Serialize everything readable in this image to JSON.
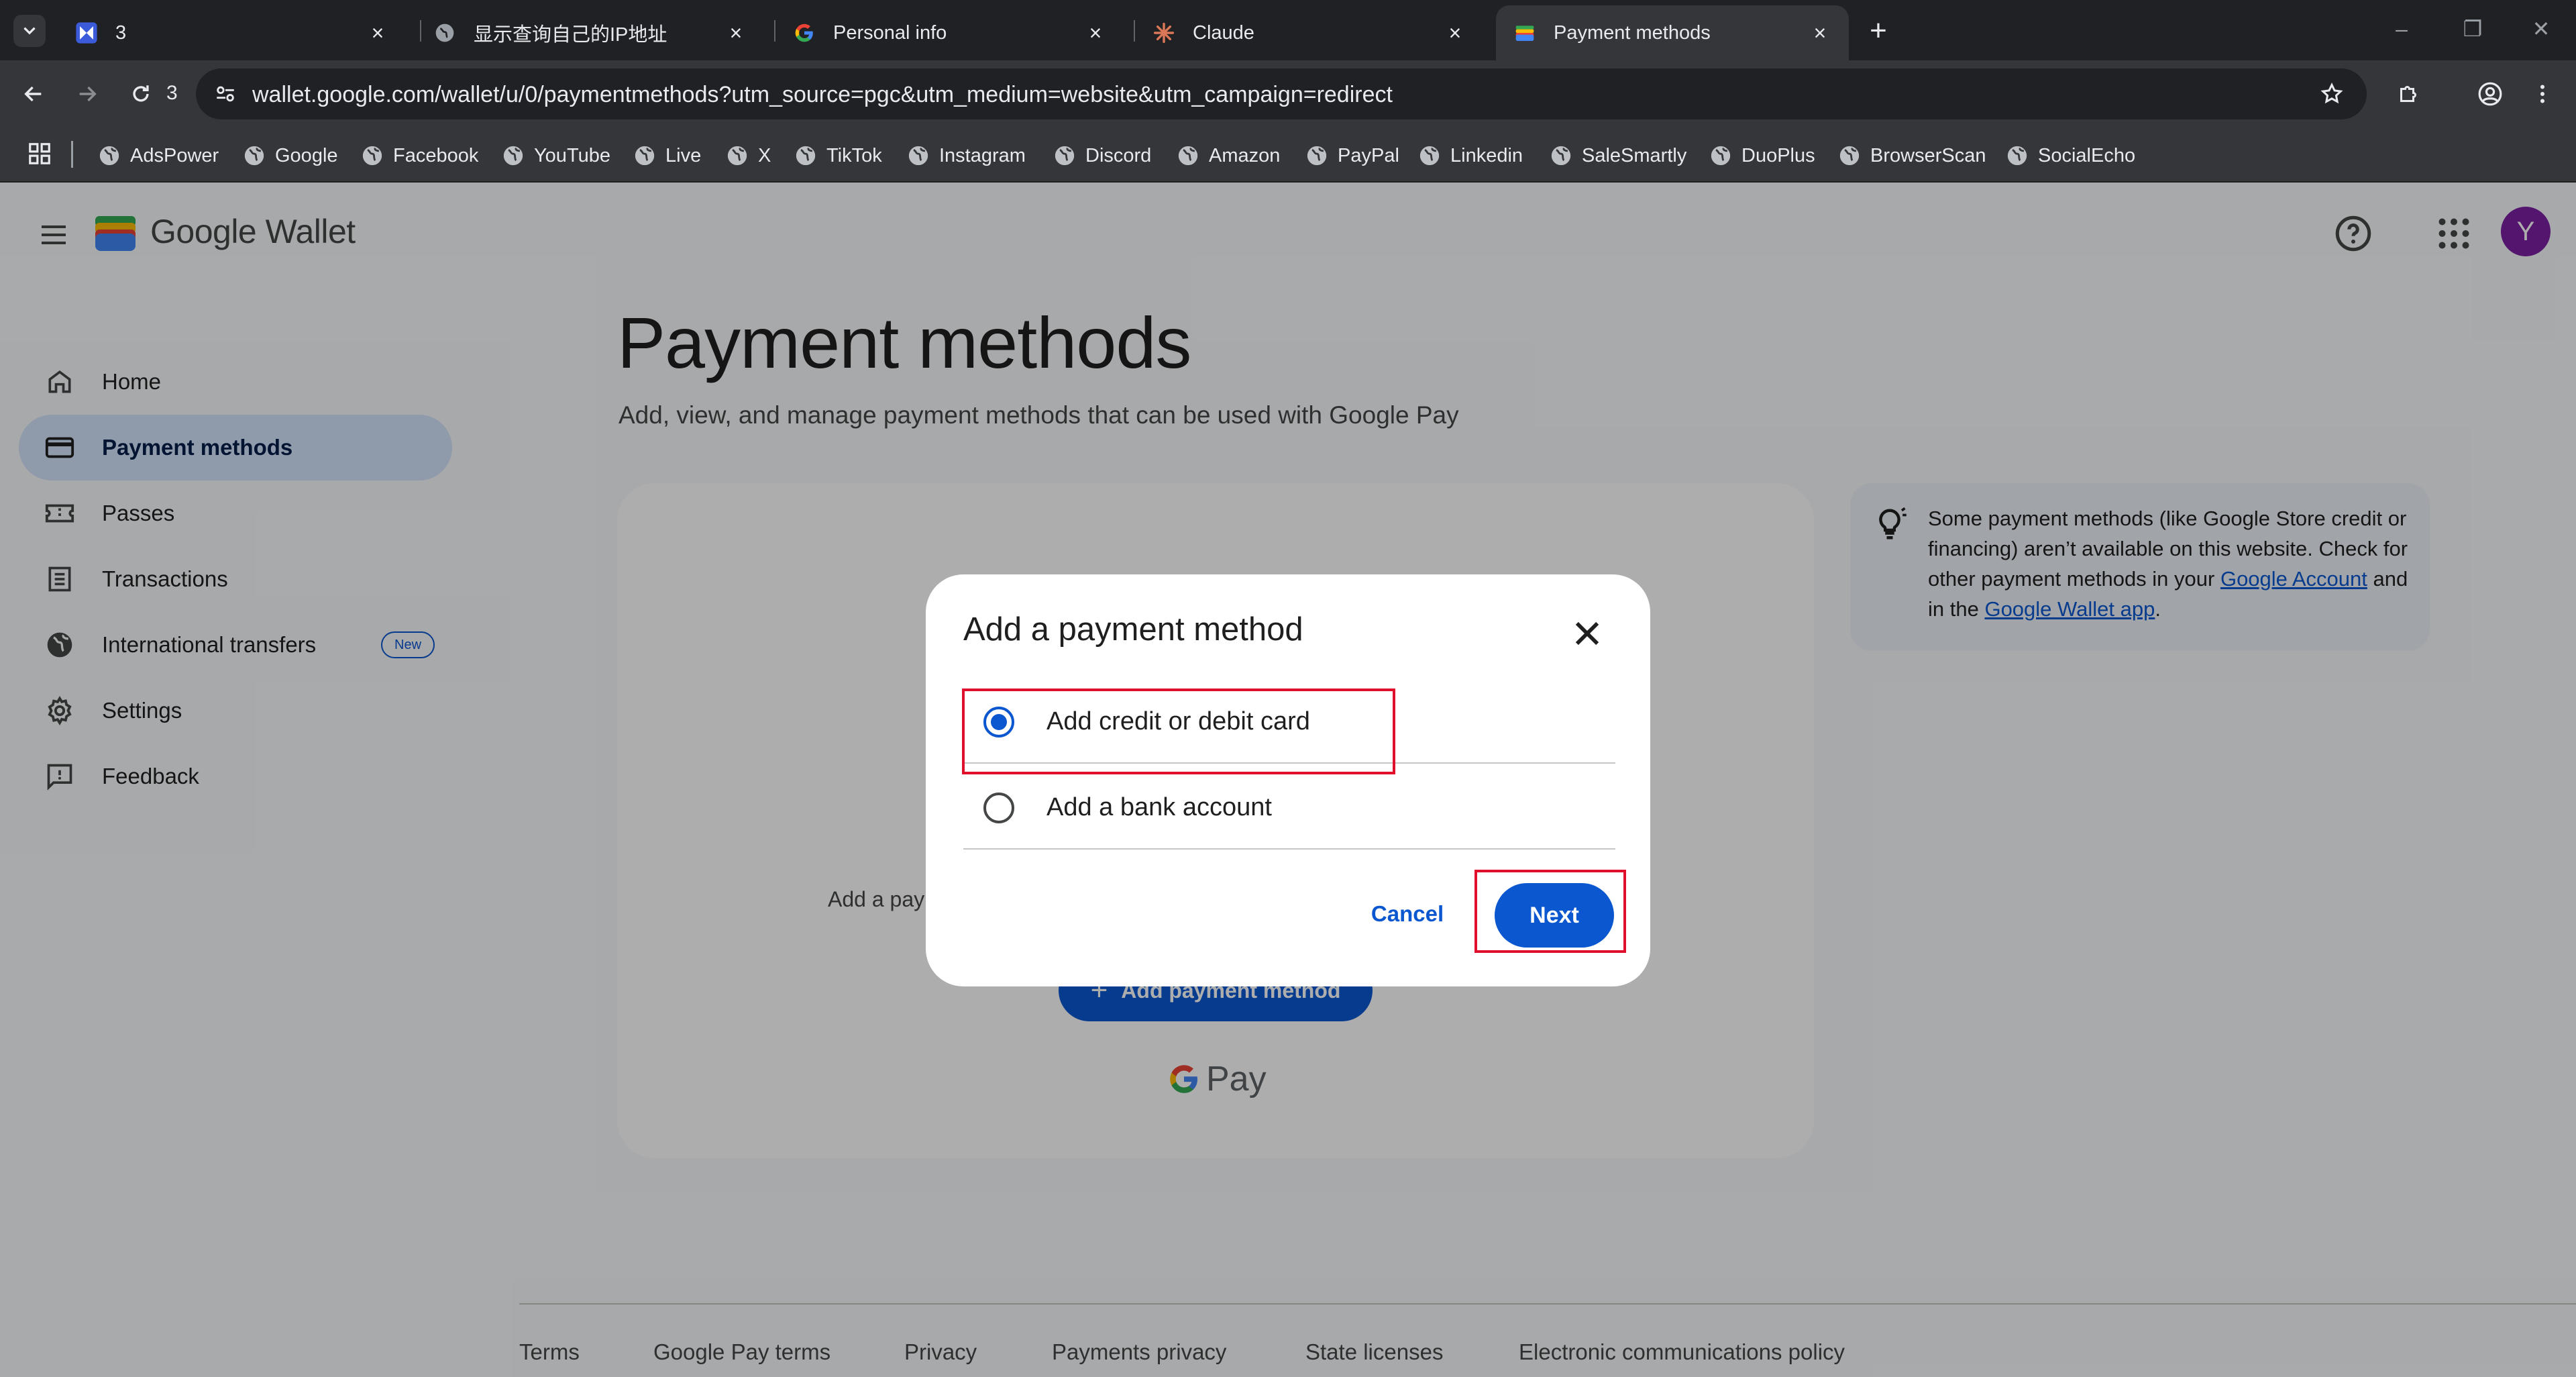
{
  "browser": {
    "tabs": [
      {
        "title": "3",
        "icon": "app-logo-icon"
      },
      {
        "title": "显示查询自己的IP地址",
        "icon": "globe-icon"
      },
      {
        "title": "Personal info",
        "icon": "google-g-icon"
      },
      {
        "title": "Claude",
        "icon": "claude-icon"
      },
      {
        "title": "Payment methods",
        "icon": "wallet-icon"
      }
    ],
    "tab_count": "3",
    "url": "wallet.google.com/wallet/u/0/paymentmethods?utm_source=pgc&utm_medium=website&utm_campaign=redirect",
    "bookmarks": [
      "AdsPower",
      "Google",
      "Facebook",
      "YouTube",
      "Live",
      "X",
      "TikTok",
      "Instagram",
      "Discord",
      "Amazon",
      "PayPal",
      "Linkedin",
      "SaleSmartly",
      "DuoPlus",
      "BrowserScan",
      "SocialEcho"
    ]
  },
  "header": {
    "brand": "Google Wallet",
    "avatar_letter": "Y"
  },
  "sidebar": {
    "items": [
      {
        "label": "Home",
        "icon": "home-icon"
      },
      {
        "label": "Payment methods",
        "icon": "credit-card-icon"
      },
      {
        "label": "Passes",
        "icon": "ticket-icon"
      },
      {
        "label": "Transactions",
        "icon": "receipt-icon"
      },
      {
        "label": "International transfers",
        "icon": "globe-icon",
        "badge": "New"
      },
      {
        "label": "Settings",
        "icon": "gear-icon"
      },
      {
        "label": "Feedback",
        "icon": "feedback-icon"
      }
    ]
  },
  "main": {
    "title": "Payment methods",
    "subtitle": "Add, view, and manage payment methods that can be used with Google Pay",
    "card_text": "Add a payment method",
    "add_button": "Add payment method",
    "gpay_label": "Pay"
  },
  "info": {
    "text_before": "Some payment methods (like Google Store credit or financing) aren’t available on this website. Check for other payment methods in your ",
    "link1": "Google Account",
    "text_middle": " and in the ",
    "link2": "Google Wallet app",
    "text_after": "."
  },
  "footer": {
    "links": [
      "Terms",
      "Google Pay terms",
      "Privacy",
      "Payments privacy",
      "State licenses",
      "Electronic communications policy"
    ]
  },
  "dialog": {
    "title": "Add a payment method",
    "options": [
      {
        "label": "Add credit or debit card",
        "selected": true
      },
      {
        "label": "Add a bank account",
        "selected": false
      }
    ],
    "cancel": "Cancel",
    "next": "Next"
  },
  "colors": {
    "accent": "#0b57d0",
    "highlight_box": "#e0102c",
    "nav_active": "#d3e3fd",
    "avatar": "#7b1fa2"
  }
}
